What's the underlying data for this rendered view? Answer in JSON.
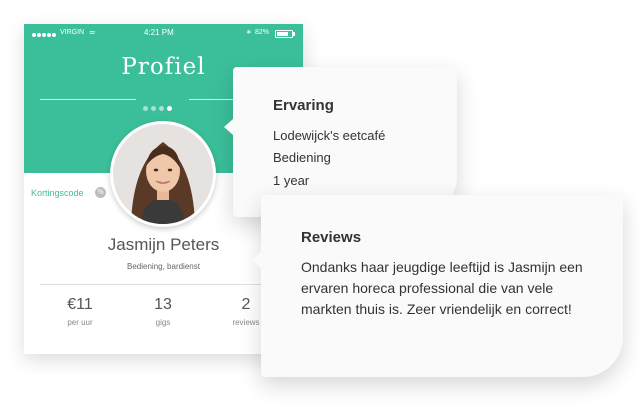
{
  "status_bar": {
    "carrier": "VIRGIN",
    "time": "4:21 PM",
    "battery": "82%"
  },
  "header": {
    "title": "Profiel",
    "pager_count": 4,
    "pager_active": 4
  },
  "profile": {
    "discount_label": "Kortingscode",
    "name": "Jasmijn Peters",
    "role": "Bediening, bardienst"
  },
  "stats": [
    {
      "value": "€11",
      "label": "per uur"
    },
    {
      "value": "13",
      "label": "gigs"
    },
    {
      "value": "2",
      "label": "reviews"
    }
  ],
  "experience": {
    "heading": "Ervaring",
    "place": "Lodewijck's eetcafé",
    "role": "Bediening",
    "duration": "1 year"
  },
  "reviews": {
    "heading": "Reviews",
    "text": "Ondanks haar jeugdige leeftijd is Jasmijn een ervaren horeca professional die van vele markten thuis is. Zeer vriendelijk en correct!"
  },
  "colors": {
    "accent": "#3bbf9a",
    "bubble": "#fafafa"
  }
}
